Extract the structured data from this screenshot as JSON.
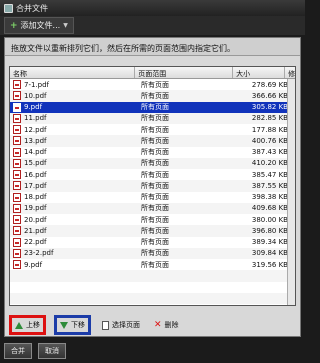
{
  "window": {
    "title": "合并文件"
  },
  "toolbar": {
    "add_files_label": "添加文件..."
  },
  "instruction": "拖放文件以重新排列它们，然后在所需的页面范围内指定它们。",
  "table": {
    "columns": [
      "名称",
      "页面范围",
      "大小",
      "修"
    ],
    "rows": [
      {
        "name": "7-1.pdf",
        "pages": "所有页面",
        "size": "278.69 KB",
        "selected": false
      },
      {
        "name": "10.pdf",
        "pages": "所有页面",
        "size": "366.66 KB",
        "selected": false
      },
      {
        "name": "9.pdf",
        "pages": "所有页面",
        "size": "305.82 KB",
        "selected": true
      },
      {
        "name": "11.pdf",
        "pages": "所有页面",
        "size": "282.85 KB",
        "selected": false
      },
      {
        "name": "12.pdf",
        "pages": "所有页面",
        "size": "177.88 KB",
        "selected": false
      },
      {
        "name": "13.pdf",
        "pages": "所有页面",
        "size": "400.76 KB",
        "selected": false
      },
      {
        "name": "14.pdf",
        "pages": "所有页面",
        "size": "387.43 KB",
        "selected": false
      },
      {
        "name": "15.pdf",
        "pages": "所有页面",
        "size": "410.20 KB",
        "selected": false
      },
      {
        "name": "16.pdf",
        "pages": "所有页面",
        "size": "385.47 KB",
        "selected": false
      },
      {
        "name": "17.pdf",
        "pages": "所有页面",
        "size": "387.55 KB",
        "selected": false
      },
      {
        "name": "18.pdf",
        "pages": "所有页面",
        "size": "398.38 KB",
        "selected": false
      },
      {
        "name": "19.pdf",
        "pages": "所有页面",
        "size": "409.68 KB",
        "selected": false
      },
      {
        "name": "20.pdf",
        "pages": "所有页面",
        "size": "380.00 KB",
        "selected": false
      },
      {
        "name": "21.pdf",
        "pages": "所有页面",
        "size": "396.80 KB",
        "selected": false
      },
      {
        "name": "22.pdf",
        "pages": "所有页面",
        "size": "389.34 KB",
        "selected": false
      },
      {
        "name": "23-2.pdf",
        "pages": "所有页面",
        "size": "309.84 KB",
        "selected": false
      },
      {
        "name": "9.pdf",
        "pages": "所有页面",
        "size": "319.56 KB",
        "selected": false
      },
      {
        "name": "",
        "pages": "",
        "size": "",
        "selected": false
      },
      {
        "name": "",
        "pages": "",
        "size": "",
        "selected": false
      },
      {
        "name": "",
        "pages": "",
        "size": "",
        "selected": false
      }
    ]
  },
  "actions": {
    "up": "上移",
    "down": "下移",
    "choose_pages": "选择页面",
    "remove": "删除"
  },
  "bottom": {
    "merge": "合并",
    "cancel": "取消"
  }
}
